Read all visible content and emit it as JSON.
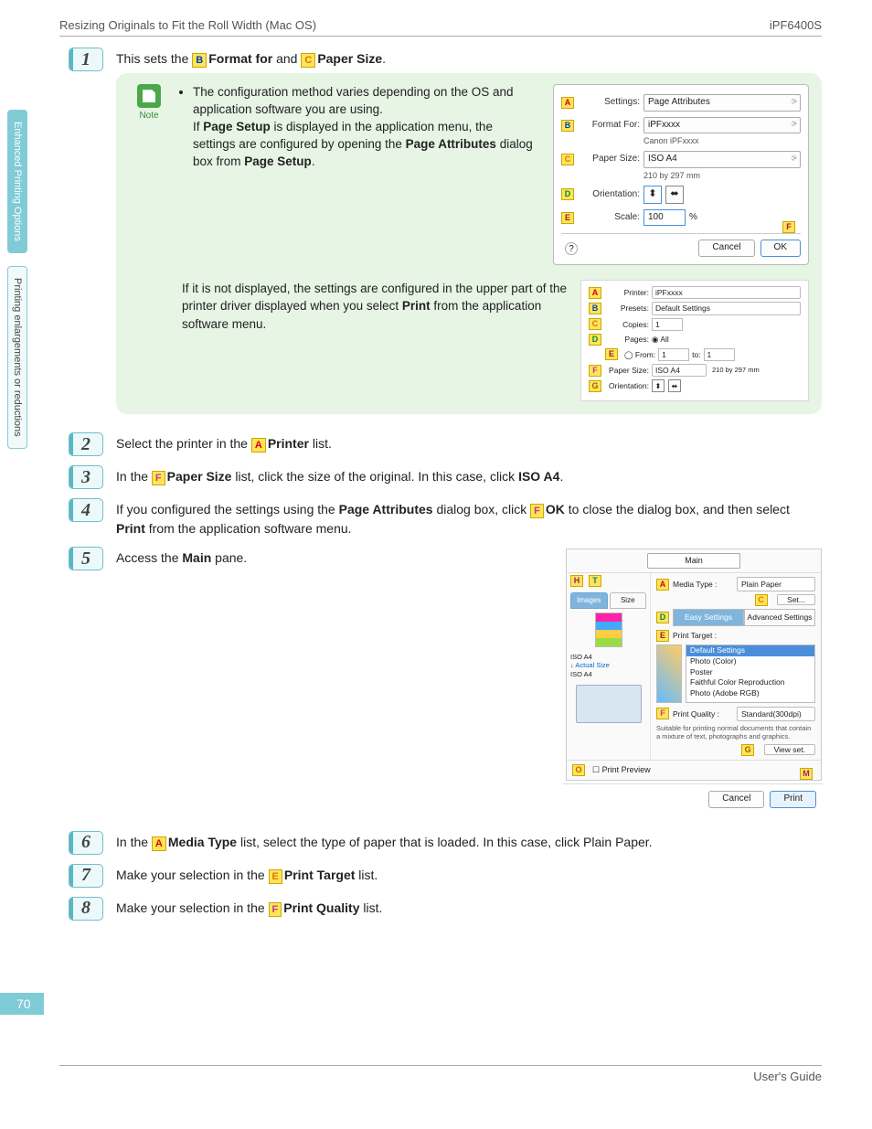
{
  "header": {
    "left": "Resizing Originals to Fit the Roll Width (Mac OS)",
    "right": "iPF6400S"
  },
  "sidebar": {
    "tab1": "Enhanced Printing Options",
    "tab2": "Printing enlargements or reductions"
  },
  "pageNumber": "70",
  "footer": "User's Guide",
  "step1": {
    "num": "1",
    "pre": "This sets the ",
    "b_key": "B",
    "b_label": "Format for",
    "mid": " and ",
    "c_key": "C",
    "c_label": "Paper Size",
    "post": "."
  },
  "note": {
    "label": "Note",
    "line1": "The configuration method varies depending on the OS and application software you are using.",
    "line2a": "If ",
    "line2b": "Page Setup",
    "line2c": " is displayed in the application menu, the settings are configured by opening the ",
    "line2d": "Page Attributes",
    "line2e": " dialog box from ",
    "line2f": "Page Setup",
    "line2g": "."
  },
  "dlg1": {
    "a": "A",
    "settings_l": "Settings:",
    "settings_v": "Page Attributes",
    "b": "B",
    "format_l": "Format For:",
    "format_v": "iPFxxxx",
    "format_sub": "Canon iPFxxxx",
    "c": "C",
    "paper_l": "Paper Size:",
    "paper_v": "ISO A4",
    "paper_sub": "210 by 297 mm",
    "d": "D",
    "orient_l": "Orientation:",
    "e": "E",
    "scale_l": "Scale:",
    "scale_v": "100",
    "scale_u": "%",
    "f": "F",
    "cancel": "Cancel",
    "ok": "OK",
    "help": "?"
  },
  "para2": {
    "a": "If it is not displayed, the settings are configured in the upper part of the printer driver displayed when you select ",
    "b": "Print",
    "c": " from the application software menu."
  },
  "dlg2": {
    "a": "A",
    "printer_l": "Printer:",
    "printer_v": "iPFxxxx",
    "b": "B",
    "presets_l": "Presets:",
    "presets_v": "Default Settings",
    "c": "C",
    "copies_l": "Copies:",
    "copies_v": "1",
    "d": "D",
    "pages_l": "Pages:",
    "pages_all": "All",
    "e": "E",
    "from_l": "From:",
    "from_v": "1",
    "to_l": "to:",
    "to_v": "1",
    "f": "F",
    "paper_l": "Paper Size:",
    "paper_v": "ISO A4",
    "paper_dim": "210 by 297 mm",
    "g": "G",
    "orient_l": "Orientation:"
  },
  "step2": {
    "num": "2",
    "a": "Select the printer in the ",
    "k": "A",
    "b": "Printer",
    "c": " list."
  },
  "step3": {
    "num": "3",
    "a": "In the ",
    "k": "F",
    "b": "Paper Size",
    "c": " list, click the size of the original. In this case, click ",
    "d": "ISO A4",
    "e": "."
  },
  "step4": {
    "num": "4",
    "a": "If you configured the settings using the ",
    "b": "Page Attributes",
    "c": " dialog box, click ",
    "k": "F",
    "d": "OK",
    "e": " to close the dialog box, and then select ",
    "f": "Print",
    "g": " from the application software menu."
  },
  "step5": {
    "num": "5",
    "a": "Access the ",
    "b": "Main",
    "c": " pane."
  },
  "mainpane": {
    "top": "Main",
    "h": "H",
    "t": "T",
    "d": "D",
    "a": "A",
    "c": "C",
    "e": "E",
    "f": "F",
    "g": "G",
    "o": "O",
    "m": "M",
    "tab_images": "Images",
    "tab_size": "Size",
    "left_line1": "ISO A4",
    "left_line2": "Actual Size",
    "left_line3": "ISO A4",
    "media_l": "Media Type :",
    "media_v": "Plain Paper",
    "set": "Set...",
    "seg_easy": "Easy Settings",
    "seg_adv": "Advanced Settings",
    "target_l": "Print Target :",
    "li1": "Default Settings",
    "li2": "Photo (Color)",
    "li3": "Poster",
    "li4": "Faithful Color Reproduction",
    "li5": "Photo (Adobe RGB)",
    "quality_l": "Print Quality :",
    "quality_v": "Standard(300dpi)",
    "desc": "Suitable for printing normal documents that contain a mixture of text, photographs and graphics.",
    "viewset": "View set.",
    "preview": "Print Preview",
    "cancel": "Cancel",
    "print": "Print"
  },
  "step6": {
    "num": "6",
    "a": "In the ",
    "k": "A",
    "b": "Media Type",
    "c": " list, select the type of paper that is loaded. In this case, click Plain Paper."
  },
  "step7": {
    "num": "7",
    "a": "Make your selection in the ",
    "k": "E",
    "b": "Print Target",
    "c": " list."
  },
  "step8": {
    "num": "8",
    "a": "Make your selection in the ",
    "k": "F",
    "b": "Print Quality",
    "c": " list."
  }
}
